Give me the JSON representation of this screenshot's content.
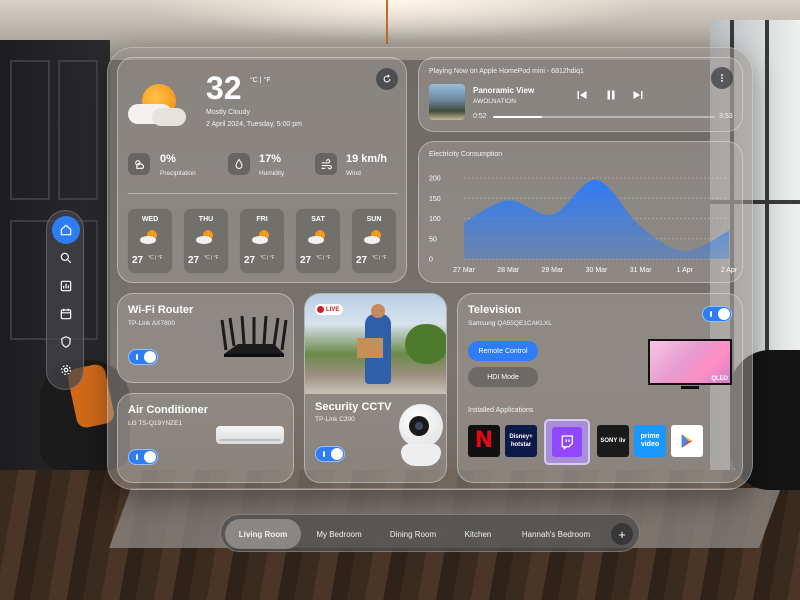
{
  "weather": {
    "temperature": "32",
    "units": "°C | °F",
    "condition": "Mostly Cloudy",
    "datetime": "2 April 2024, Tuesday, 5:00 pm",
    "stats": [
      {
        "value": "0%",
        "label": "Precipitation",
        "icon": "cloud-sun-icon"
      },
      {
        "value": "17%",
        "label": "Humidity",
        "icon": "droplet-icon"
      },
      {
        "value": "19 km/h",
        "label": "Wind",
        "icon": "wind-icon"
      }
    ],
    "forecast": [
      {
        "day": "WED",
        "temp": "27",
        "units": "°C | °F"
      },
      {
        "day": "THU",
        "temp": "27",
        "units": "°C | °F"
      },
      {
        "day": "FRI",
        "temp": "27",
        "units": "°C | °F"
      },
      {
        "day": "SAT",
        "temp": "27",
        "units": "°C | °F"
      },
      {
        "day": "SUN",
        "temp": "27",
        "units": "°C | °F"
      }
    ]
  },
  "player": {
    "header": "Playing Now on Apple HomePod mini - 6812hdiq1",
    "track": "Panoramic View",
    "artist": "AWOLNATION",
    "elapsed": "0:52",
    "duration": "3:53",
    "progress": 0.22
  },
  "electricity": {
    "title": "Electricity Consumption",
    "color": "#2f7cf6"
  },
  "chart_data": {
    "type": "area",
    "title": "Electricity Consumption",
    "x": [
      "27 Mar",
      "28 Mar",
      "29 Mar",
      "30 Mar",
      "31 Mar",
      "1 Apr",
      "2 Apr"
    ],
    "y_ticks": [
      "200",
      "150",
      "100",
      "50",
      "0"
    ],
    "ylim": [
      0,
      200
    ],
    "series": [
      {
        "values": [
          90,
          145,
          110,
          195,
          80,
          20,
          70
        ]
      }
    ],
    "grid": true
  },
  "router": {
    "title": "Wi-Fi Router",
    "model": "TP-Link AX7800",
    "on": true
  },
  "ac": {
    "title": "Air Conditioner",
    "model": "LG TS-Q19YNZE1",
    "on": true
  },
  "cctv": {
    "title": "Security CCTV",
    "model": "TP-Link C200",
    "live": "LIVE",
    "on": true
  },
  "tv": {
    "title": "Television",
    "model": "Samsung QA55QE1CAKLXL",
    "on": true,
    "remote_label": "Remote Control",
    "hdi_label": "HDI Mode",
    "apps_label": "Installed Applications",
    "tv_badge": "QLED",
    "apps": [
      {
        "name": "Netflix",
        "text": "N",
        "bg": "#111111",
        "fg": "#e50914"
      },
      {
        "name": "Disney+ Hotstar",
        "text": "Disney+ hotstar",
        "bg": "#0c1a4a",
        "fg": "#ffffff"
      },
      {
        "name": "Twitch",
        "text": "twitch",
        "bg": "#9146ff",
        "fg": "#ffffff"
      },
      {
        "name": "Sony LIV",
        "text": "SONY liv",
        "bg": "#1a1a1a",
        "fg": "#ffffff"
      },
      {
        "name": "Prime Video",
        "text": "prime video",
        "bg": "#1a98ff",
        "fg": "#ffffff"
      },
      {
        "name": "Google Play",
        "text": "▶",
        "bg": "#ffffff",
        "fg": "#34a853"
      }
    ]
  },
  "sidebar": {
    "items": [
      {
        "name": "home",
        "icon": "home-icon",
        "active": true
      },
      {
        "name": "search",
        "icon": "search-icon"
      },
      {
        "name": "analytics",
        "icon": "chart-icon"
      },
      {
        "name": "calendar",
        "icon": "calendar-icon"
      },
      {
        "name": "security",
        "icon": "shield-icon"
      },
      {
        "name": "settings",
        "icon": "gear-icon"
      }
    ]
  },
  "rooms": {
    "tabs": [
      "Living Room",
      "My Bedroom",
      "Dining Room",
      "Kitchen",
      "Hannah's Bedroom"
    ],
    "active": "Living Room",
    "add": "+"
  }
}
